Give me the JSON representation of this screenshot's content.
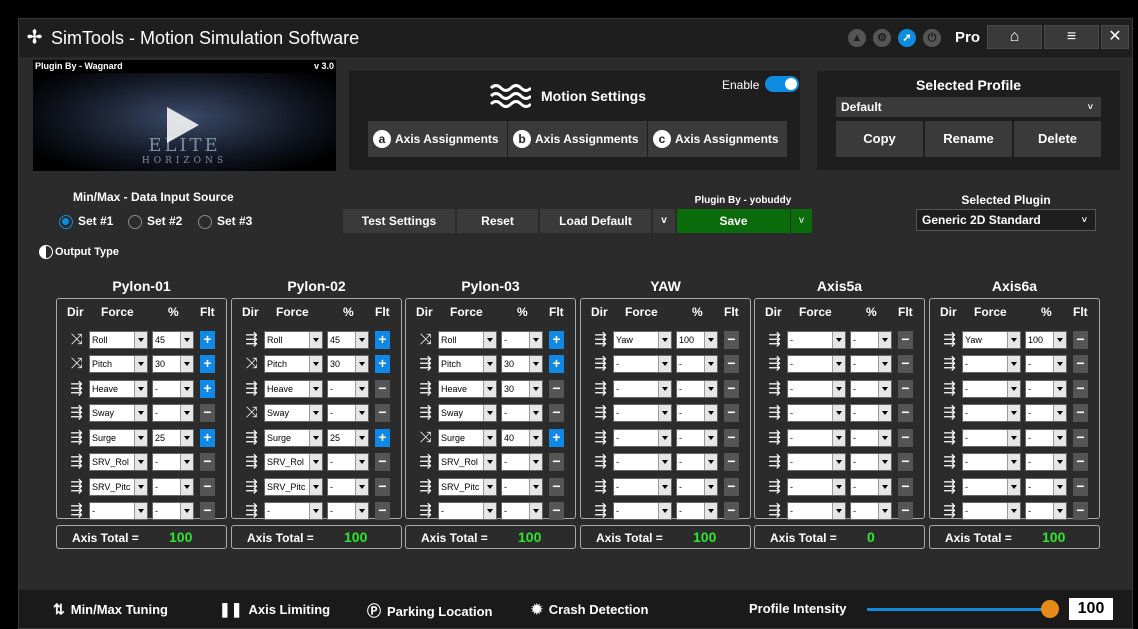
{
  "app": {
    "title": "SimTools - Motion Simulation Software",
    "logo_glyph": "✢",
    "pro_label": "Pro"
  },
  "titlebar": {
    "icons": [
      "arrow-up-icon",
      "gear-icon",
      "compass-icon",
      "power-icon"
    ],
    "home_glyph": "⌂",
    "menu_glyph": "≡",
    "close_glyph": "✕"
  },
  "plugin_banner": {
    "plugin_by": "Plugin By - Wagnard",
    "version": "v 3.0",
    "game_name": "ELITE",
    "game_subtitle": "HORIZONS"
  },
  "motion_settings": {
    "title": "Motion Settings",
    "enable_label": "Enable",
    "enabled": true,
    "tabs": [
      {
        "badge": "a",
        "label": "Axis Assignments"
      },
      {
        "badge": "b",
        "label": "Axis Assignments"
      },
      {
        "badge": "c",
        "label": "Axis Assignments"
      }
    ]
  },
  "profile": {
    "title": "Selected Profile",
    "selected": "Default",
    "copy_label": "Copy",
    "rename_label": "Rename",
    "delete_label": "Delete"
  },
  "data_input": {
    "title": "Min/Max - Data Input Source",
    "options": [
      "Set #1",
      "Set #2",
      "Set #3"
    ],
    "selected": 0
  },
  "output_type_label": "Output Type",
  "actions": {
    "test_label": "Test Settings",
    "reset_label": "Reset",
    "load_default_label": "Load Default",
    "save_label": "Save",
    "plugin_by": "Plugin By - yobuddy",
    "dropdown_glyph": "v"
  },
  "selected_plugin": {
    "title": "Selected Plugin",
    "value": "Generic 2D Standard"
  },
  "column_headers": {
    "dir": "Dir",
    "force": "Force",
    "pct": "%",
    "flt": "Flt"
  },
  "total_label": "Axis Total =",
  "axes": [
    {
      "name": "Pylon-01",
      "total": "100",
      "rows": [
        {
          "dir": "cross",
          "force": "Roll",
          "pct": "45",
          "flt": "+"
        },
        {
          "dir": "cross",
          "force": "Pitch",
          "pct": "30",
          "flt": "+"
        },
        {
          "dir": "arrow",
          "force": "Heave",
          "pct": "-",
          "flt": "+"
        },
        {
          "dir": "arrow",
          "force": "Sway",
          "pct": "-",
          "flt": "−"
        },
        {
          "dir": "arrow",
          "force": "Surge",
          "pct": "25",
          "flt": "+"
        },
        {
          "dir": "arrow",
          "force": "SRV_Rol",
          "pct": "-",
          "flt": "−"
        },
        {
          "dir": "arrow",
          "force": "SRV_Pitc",
          "pct": "-",
          "flt": "−"
        },
        {
          "dir": "arrow",
          "force": "-",
          "pct": "-",
          "flt": "−"
        }
      ]
    },
    {
      "name": "Pylon-02",
      "total": "100",
      "rows": [
        {
          "dir": "arrow",
          "force": "Roll",
          "pct": "45",
          "flt": "+"
        },
        {
          "dir": "cross",
          "force": "Pitch",
          "pct": "30",
          "flt": "+"
        },
        {
          "dir": "arrow",
          "force": "Heave",
          "pct": "-",
          "flt": "−"
        },
        {
          "dir": "cross",
          "force": "Sway",
          "pct": "-",
          "flt": "−"
        },
        {
          "dir": "arrow",
          "force": "Surge",
          "pct": "25",
          "flt": "+"
        },
        {
          "dir": "arrow",
          "force": "SRV_Rol",
          "pct": "-",
          "flt": "−"
        },
        {
          "dir": "arrow",
          "force": "SRV_Pitc",
          "pct": "-",
          "flt": "−"
        },
        {
          "dir": "arrow",
          "force": "-",
          "pct": "-",
          "flt": "−"
        }
      ]
    },
    {
      "name": "Pylon-03",
      "total": "100",
      "rows": [
        {
          "dir": "cross",
          "force": "Roll",
          "pct": "-",
          "flt": "+"
        },
        {
          "dir": "arrow",
          "force": "Pitch",
          "pct": "30",
          "flt": "+"
        },
        {
          "dir": "arrow",
          "force": "Heave",
          "pct": "30",
          "flt": "−"
        },
        {
          "dir": "arrow",
          "force": "Sway",
          "pct": "-",
          "flt": "−"
        },
        {
          "dir": "cross",
          "force": "Surge",
          "pct": "40",
          "flt": "+"
        },
        {
          "dir": "arrow",
          "force": "SRV_Rol",
          "pct": "-",
          "flt": "−"
        },
        {
          "dir": "arrow",
          "force": "SRV_Pitc",
          "pct": "-",
          "flt": "−"
        },
        {
          "dir": "arrow",
          "force": "-",
          "pct": "-",
          "flt": "−"
        }
      ]
    },
    {
      "name": "YAW",
      "total": "100",
      "rows": [
        {
          "dir": "arrow",
          "force": "Yaw",
          "pct": "100",
          "flt": "−"
        },
        {
          "dir": "arrow",
          "force": "-",
          "pct": "-",
          "flt": "−"
        },
        {
          "dir": "arrow",
          "force": "-",
          "pct": "-",
          "flt": "−"
        },
        {
          "dir": "arrow",
          "force": "-",
          "pct": "-",
          "flt": "−"
        },
        {
          "dir": "arrow",
          "force": "-",
          "pct": "-",
          "flt": "−"
        },
        {
          "dir": "arrow",
          "force": "-",
          "pct": "-",
          "flt": "−"
        },
        {
          "dir": "arrow",
          "force": "-",
          "pct": "-",
          "flt": "−"
        },
        {
          "dir": "arrow",
          "force": "-",
          "pct": "-",
          "flt": "−"
        }
      ]
    },
    {
      "name": "Axis5a",
      "total": "0",
      "rows": [
        {
          "dir": "arrow",
          "force": "-",
          "pct": "-",
          "flt": "−"
        },
        {
          "dir": "arrow",
          "force": "-",
          "pct": "-",
          "flt": "−"
        },
        {
          "dir": "arrow",
          "force": "-",
          "pct": "-",
          "flt": "−"
        },
        {
          "dir": "arrow",
          "force": "-",
          "pct": "-",
          "flt": "−"
        },
        {
          "dir": "arrow",
          "force": "-",
          "pct": "-",
          "flt": "−"
        },
        {
          "dir": "arrow",
          "force": "-",
          "pct": "-",
          "flt": "−"
        },
        {
          "dir": "arrow",
          "force": "-",
          "pct": "-",
          "flt": "−"
        },
        {
          "dir": "arrow",
          "force": "-",
          "pct": "-",
          "flt": "−"
        }
      ]
    },
    {
      "name": "Axis6a",
      "total": "100",
      "rows": [
        {
          "dir": "arrow",
          "force": "Yaw",
          "pct": "100",
          "flt": "−"
        },
        {
          "dir": "arrow",
          "force": "-",
          "pct": "-",
          "flt": "−"
        },
        {
          "dir": "arrow",
          "force": "-",
          "pct": "-",
          "flt": "−"
        },
        {
          "dir": "arrow",
          "force": "-",
          "pct": "-",
          "flt": "−"
        },
        {
          "dir": "arrow",
          "force": "-",
          "pct": "-",
          "flt": "−"
        },
        {
          "dir": "arrow",
          "force": "-",
          "pct": "-",
          "flt": "−"
        },
        {
          "dir": "arrow",
          "force": "-",
          "pct": "-",
          "flt": "−"
        },
        {
          "dir": "arrow",
          "force": "-",
          "pct": "-",
          "flt": "−"
        }
      ]
    }
  ],
  "footer": {
    "minmax_label": "Min/Max Tuning",
    "limiting_label": "Axis Limiting",
    "parking_label": "Parking Location",
    "crash_label": "Crash Detection",
    "intensity_label": "Profile Intensity",
    "intensity_value": "100"
  },
  "colors": {
    "accent": "#0e8de0",
    "save": "#0a6b0a",
    "total": "#2fe62f",
    "knob": "#e88a1a"
  }
}
